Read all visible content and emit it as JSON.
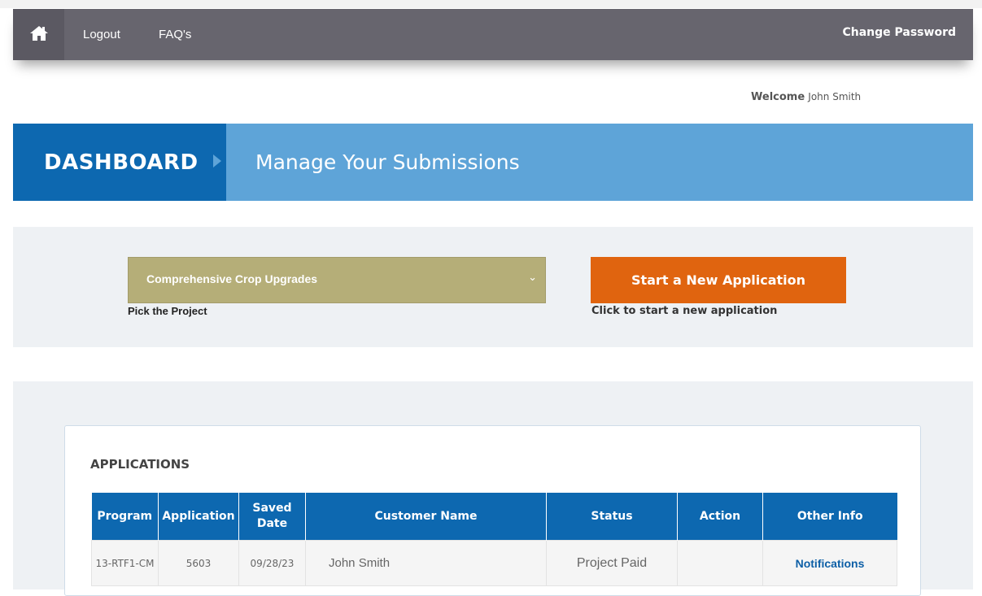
{
  "nav": {
    "home_icon": "home-icon",
    "logout": "Logout",
    "faq": "FAQ's",
    "change_password": "Change Password"
  },
  "welcome": {
    "label": "Welcome",
    "name": "John Smith"
  },
  "banner": {
    "title": "DASHBOARD",
    "subtitle": "Manage Your Submissions"
  },
  "project": {
    "selected": "Comprehensive Crop Upgrades",
    "label": "Pick the Project",
    "start_button": "Start a New Application",
    "start_hint": "Click to start a new application"
  },
  "applications": {
    "title": "APPLICATIONS",
    "columns": [
      "Program",
      "Application",
      "Saved Date",
      "Customer Name",
      "Status",
      "Action",
      "Other Info"
    ],
    "rows": [
      {
        "program": "13-RTF1-CM",
        "application": "5603",
        "saved_date": "09/28/23",
        "customer_name": "John Smith",
        "status": "Project Paid",
        "action": "",
        "other_info": "Notifications"
      }
    ]
  },
  "colors": {
    "navbar": "#67656e",
    "banner_dark": "#0d68b0",
    "banner_light": "#5ea4d8",
    "select_bg": "#b5ae78",
    "start_button": "#e0640f",
    "table_header": "#0d68b0"
  }
}
